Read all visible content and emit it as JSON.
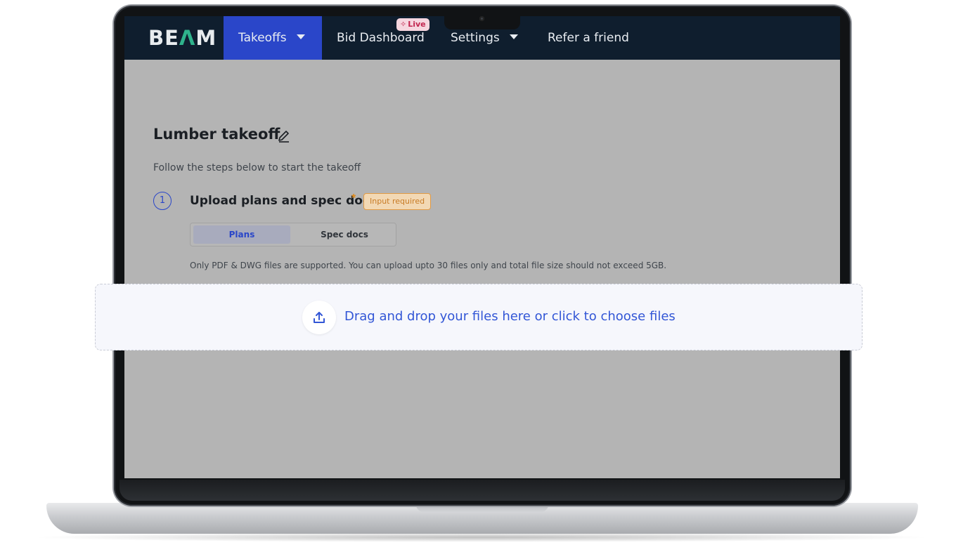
{
  "nav": {
    "logo": {
      "part1": "BE",
      "part2": "Λ",
      "part3": "M"
    },
    "items": [
      {
        "label": "Takeoffs",
        "active": true,
        "has_dropdown": true
      },
      {
        "label": "Bid Dashboard",
        "badge": "Live"
      },
      {
        "label": "Settings",
        "has_dropdown": true
      },
      {
        "label": "Refer a friend"
      }
    ],
    "colors": {
      "background": "#0f1e2e",
      "active": "#2a46c9"
    }
  },
  "main": {
    "title": "Lumber takeoff",
    "subtitle": "Follow the steps below to start the takeoff",
    "step": {
      "number": "1",
      "title": "Upload plans and spec docs",
      "required_mark": "*",
      "badge": "Input required"
    },
    "tabs": [
      {
        "label": "Plans",
        "selected": true
      },
      {
        "label": "Spec docs",
        "selected": false
      }
    ],
    "note": "Only PDF & DWG files are supported. You can upload upto 30 files only and total file size should not exceed 5GB."
  },
  "dropzone": {
    "text": "Drag and drop your files here or click to choose files",
    "icon": "upload-icon",
    "accent_color": "#3256d6"
  }
}
